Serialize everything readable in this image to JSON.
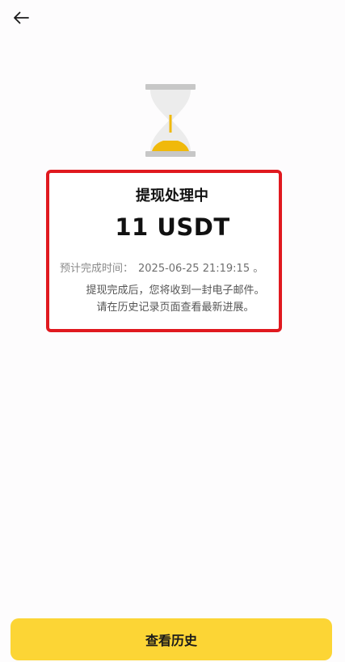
{
  "header": {
    "back_icon": "arrow-left-icon"
  },
  "status": {
    "icon": "hourglass-icon",
    "title": "提现处理中",
    "amount": "11 USDT",
    "eta_label": "预计完成时间：",
    "eta_value": "2025-06-25 21:19:15 。",
    "description_line1": "提现完成后，您将收到一封电子邮件。",
    "description_line2": "请在历史记录页面查看最新进展。",
    "highlight_color": "#e0191f"
  },
  "footer": {
    "history_button_label": "查看历史",
    "accent_color": "#fcd535"
  }
}
